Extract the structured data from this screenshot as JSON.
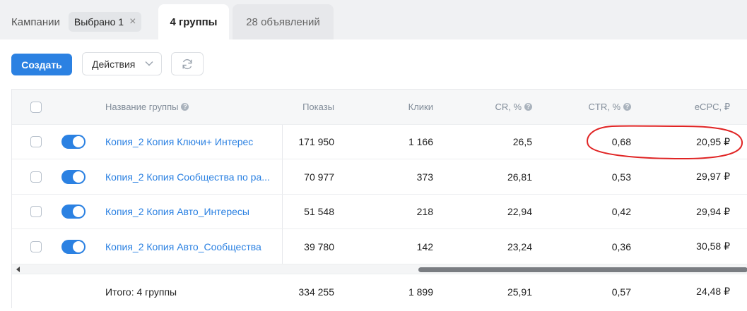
{
  "tabs": {
    "campaigns_label": "Кампании",
    "selected_chip": "Выбрано 1",
    "groups_label": "4 группы",
    "ads_label": "28 объявлений"
  },
  "toolbar": {
    "create_label": "Создать",
    "actions_label": "Действия"
  },
  "table": {
    "headers": {
      "name": "Название группы",
      "impressions": "Показы",
      "clicks": "Клики",
      "cr": "CR, %",
      "ctr": "CTR, %",
      "ecpc": "eCPC, ₽"
    },
    "rows": [
      {
        "name": "Копия_2 Копия Ключи+ Интерес",
        "impressions": "171 950",
        "clicks": "1 166",
        "cr": "26,5",
        "ctr": "0,68",
        "ecpc": "20,95 ₽",
        "enabled": true
      },
      {
        "name": "Копия_2 Копия Сообщества по ра...",
        "impressions": "70 977",
        "clicks": "373",
        "cr": "26,81",
        "ctr": "0,53",
        "ecpc": "29,97 ₽",
        "enabled": true
      },
      {
        "name": "Копия_2 Копия Авто_Интересы",
        "impressions": "51 548",
        "clicks": "218",
        "cr": "22,94",
        "ctr": "0,42",
        "ecpc": "29,94 ₽",
        "enabled": true
      },
      {
        "name": "Копия_2 Копия Авто_Сообщества",
        "impressions": "39 780",
        "clicks": "142",
        "cr": "23,24",
        "ctr": "0,36",
        "ecpc": "30,58 ₽",
        "enabled": true
      }
    ],
    "total": {
      "label": "Итого: 4 группы",
      "impressions": "334 255",
      "clicks": "1 899",
      "cr": "25,91",
      "ctr": "0,57",
      "ecpc": "24,48 ₽"
    }
  },
  "colors": {
    "accent": "#2b81e2",
    "annotation": "#e02424"
  },
  "icons": {
    "chip_close": "close-icon",
    "actions_chevron": "chevron-down-icon",
    "refresh": "refresh-icon",
    "help": "help-circle-icon"
  }
}
